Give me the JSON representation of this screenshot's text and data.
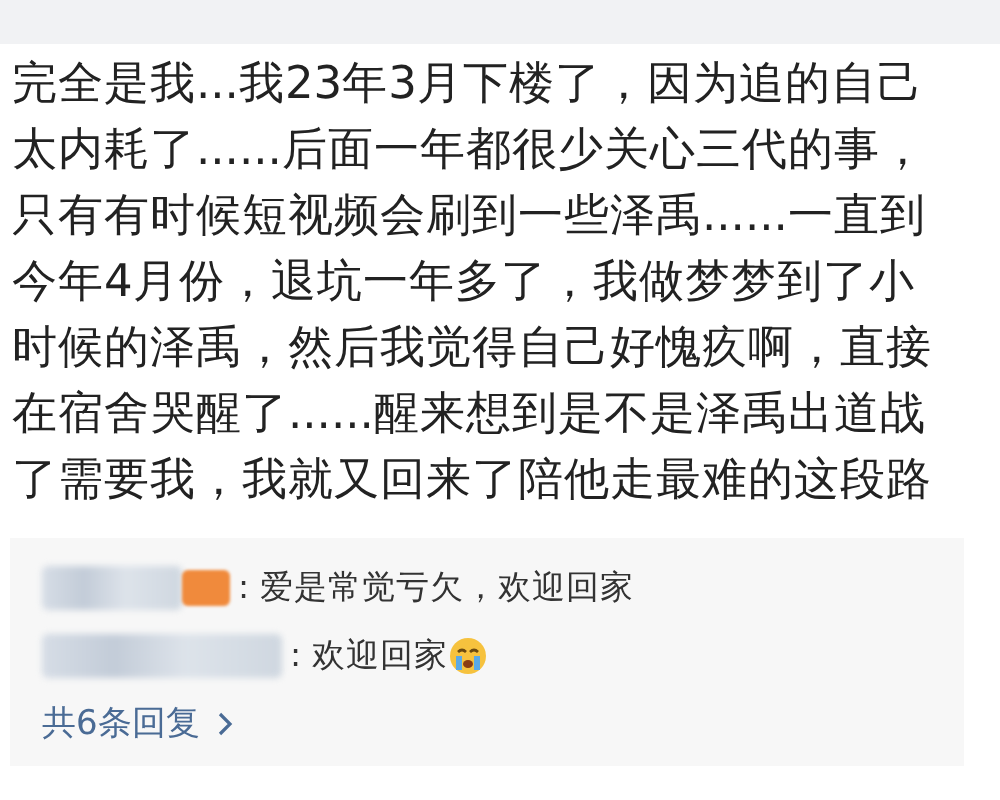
{
  "post": {
    "text": "完全是我...我23年3月下楼了，因为追的自己太内耗了......后面一年都很少关心三代的事，只有有时候短视频会刷到一些泽禹......一直到今年4月份，退坑一年多了，我做梦梦到了小时候的泽禹，然后我觉得自己好愧疚啊，直接在宿舍哭醒了......醒来想到是不是泽禹出道战了需要我，我就又回来了陪他走最难的这段路"
  },
  "replies": [
    {
      "author_badge": true,
      "text": ": 爱是常觉亏欠，欢迎回家",
      "emoji": false
    },
    {
      "author_badge": false,
      "text": ": 欢迎回家",
      "emoji": true
    }
  ],
  "more_replies": "共6条回复"
}
